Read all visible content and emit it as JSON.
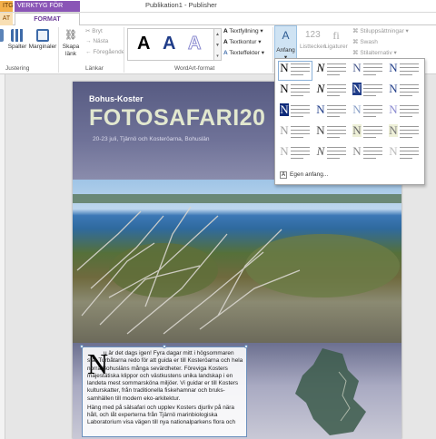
{
  "window": {
    "title": "Publikation1 - Publisher",
    "context_tab_a": "ITG",
    "context_tab_b": "VERKTYG FÖR TEXTRUTA",
    "tab_a": "AT",
    "tab_b": "FORMAT"
  },
  "ribbon": {
    "groups": {
      "alignment": "Justering",
      "links": "Länkar",
      "wordart": "WordArt-format"
    },
    "buttons": {
      "columns": "Spalter",
      "margins": "Marginaler",
      "create_link": "Skapa länk",
      "break": "Bryt",
      "next": "Nästa",
      "previous": "Föregående",
      "text_fill": "Textfyllning",
      "text_outline": "Textkontur",
      "text_effects": "Texteffekter",
      "drop_cap": "Anfang",
      "number_style": "Listtecken",
      "ligatures": "Ligaturer",
      "stylistic_sets": "Stiluppsättningar",
      "swash": "Swash",
      "stylistic_alternates": "Stilalternativ"
    },
    "wordart_sample_letter": "A",
    "colors": {
      "accent_purple": "#8a55b6",
      "accent_orange": "#f3b04a",
      "selected_blue": "#cfe3f3"
    }
  },
  "dropcap_menu": {
    "custom_label": "Egen anfang...",
    "letters": [
      "N",
      "N",
      "N",
      "N",
      "N",
      "N",
      "N",
      "N",
      "N",
      "N",
      "N",
      "N",
      "N",
      "N",
      "N",
      "N",
      "N",
      "N",
      "N",
      "N"
    ]
  },
  "page": {
    "brand": "Bohus-Koster",
    "title": "FOTOSAFARI20",
    "subtitle": "20-23 juli, Tjärnö och Kosteröarna, Bohuslän",
    "article": {
      "dropcap": "N",
      "paragraphs": [
        "u är det dags igen! Fyra dagar mitt i högsommaren står Turbåtarna redo för att guida er till Kosteröarna och hela norra Bohusläns många sevärdheter. Föreviga Kosters majestätiska klippor och västkustens unika landskap i en landeta mest sommarsköna miljöer. Vi guidar er till Kosters kulturskatter, från traditionella fiskehamnar och bruks­samhällen till modern eko-arkitektur.",
        "Häng med på sälsafari och upplev Kosters djurliv på nära håll, och låt experterna från Tjärnö marinbiologiska Laboratorium visa vägen till nya nationalparkens flora och"
      ]
    }
  }
}
